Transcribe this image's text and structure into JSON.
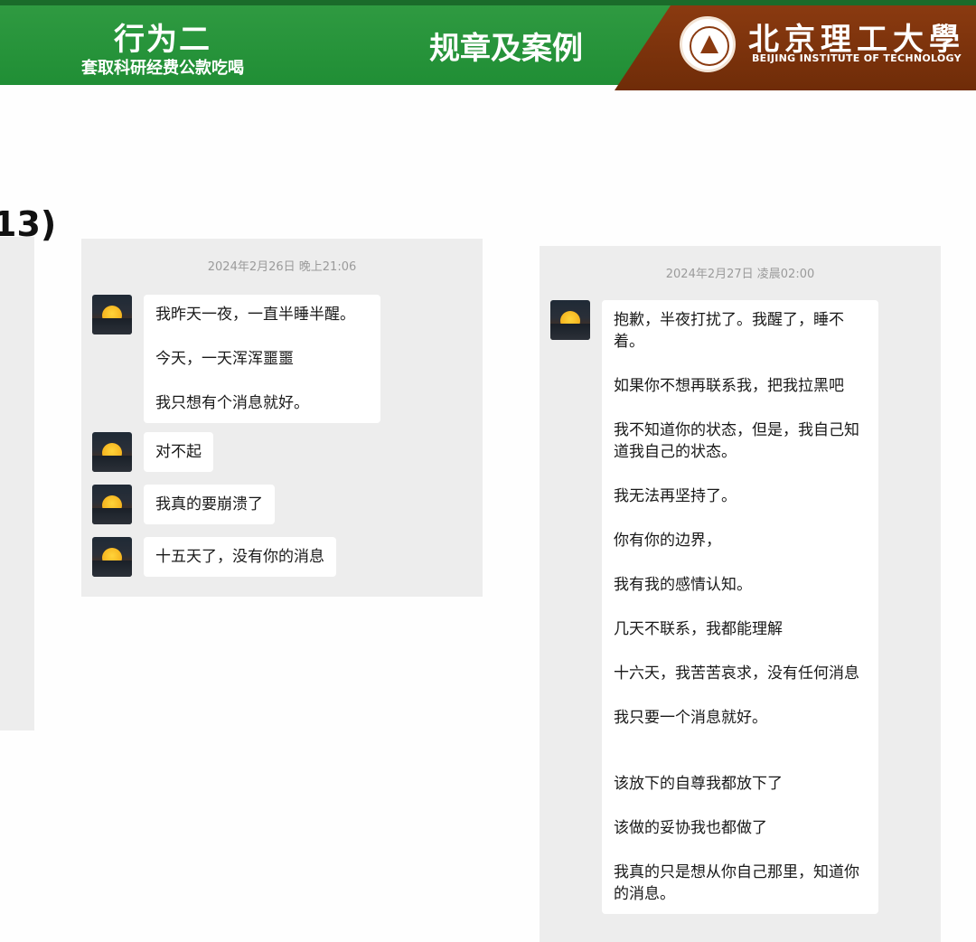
{
  "header": {
    "behavior_title": "行为二",
    "behavior_subtitle": "套取科研经费公款吃喝",
    "center_title": "规章及案例",
    "university_name_cn": "北京理工大學",
    "university_name_en": "BEIJING INSTITUTE OF TECHNOLOGY",
    "colors": {
      "green": "#2f9a41",
      "brown": "#7a320c"
    }
  },
  "case_number": "13)",
  "chat_a": {
    "timestamp": "2024年2月26日 晚上21:06",
    "messages": [
      {
        "lines": [
          "我昨天一夜，一直半睡半醒。",
          "今天，一天浑浑噩噩",
          "我只想有个消息就好。"
        ]
      },
      {
        "lines": [
          "对不起"
        ]
      },
      {
        "lines": [
          "我真的要崩溃了"
        ]
      },
      {
        "lines": [
          "十五天了，没有你的消息"
        ]
      }
    ]
  },
  "chat_b": {
    "timestamp": "2024年2月27日 凌晨02:00",
    "messages": [
      {
        "lines": [
          "抱歉，半夜打扰了。我醒了，睡不着。",
          "如果你不想再联系我，把我拉黑吧",
          "我不知道你的状态，但是，我自己知道我自己的状态。",
          "我无法再坚持了。",
          "你有你的边界，",
          "我有我的感情认知。",
          "几天不联系，我都能理解",
          "十六天，我苦苦哀求，没有任何消息",
          "我只要一个消息就好。",
          "该放下的自尊我都放下了",
          "该做的妥协我也都做了",
          "我真的只是想从你自己那里，知道你的消息。"
        ]
      }
    ]
  }
}
